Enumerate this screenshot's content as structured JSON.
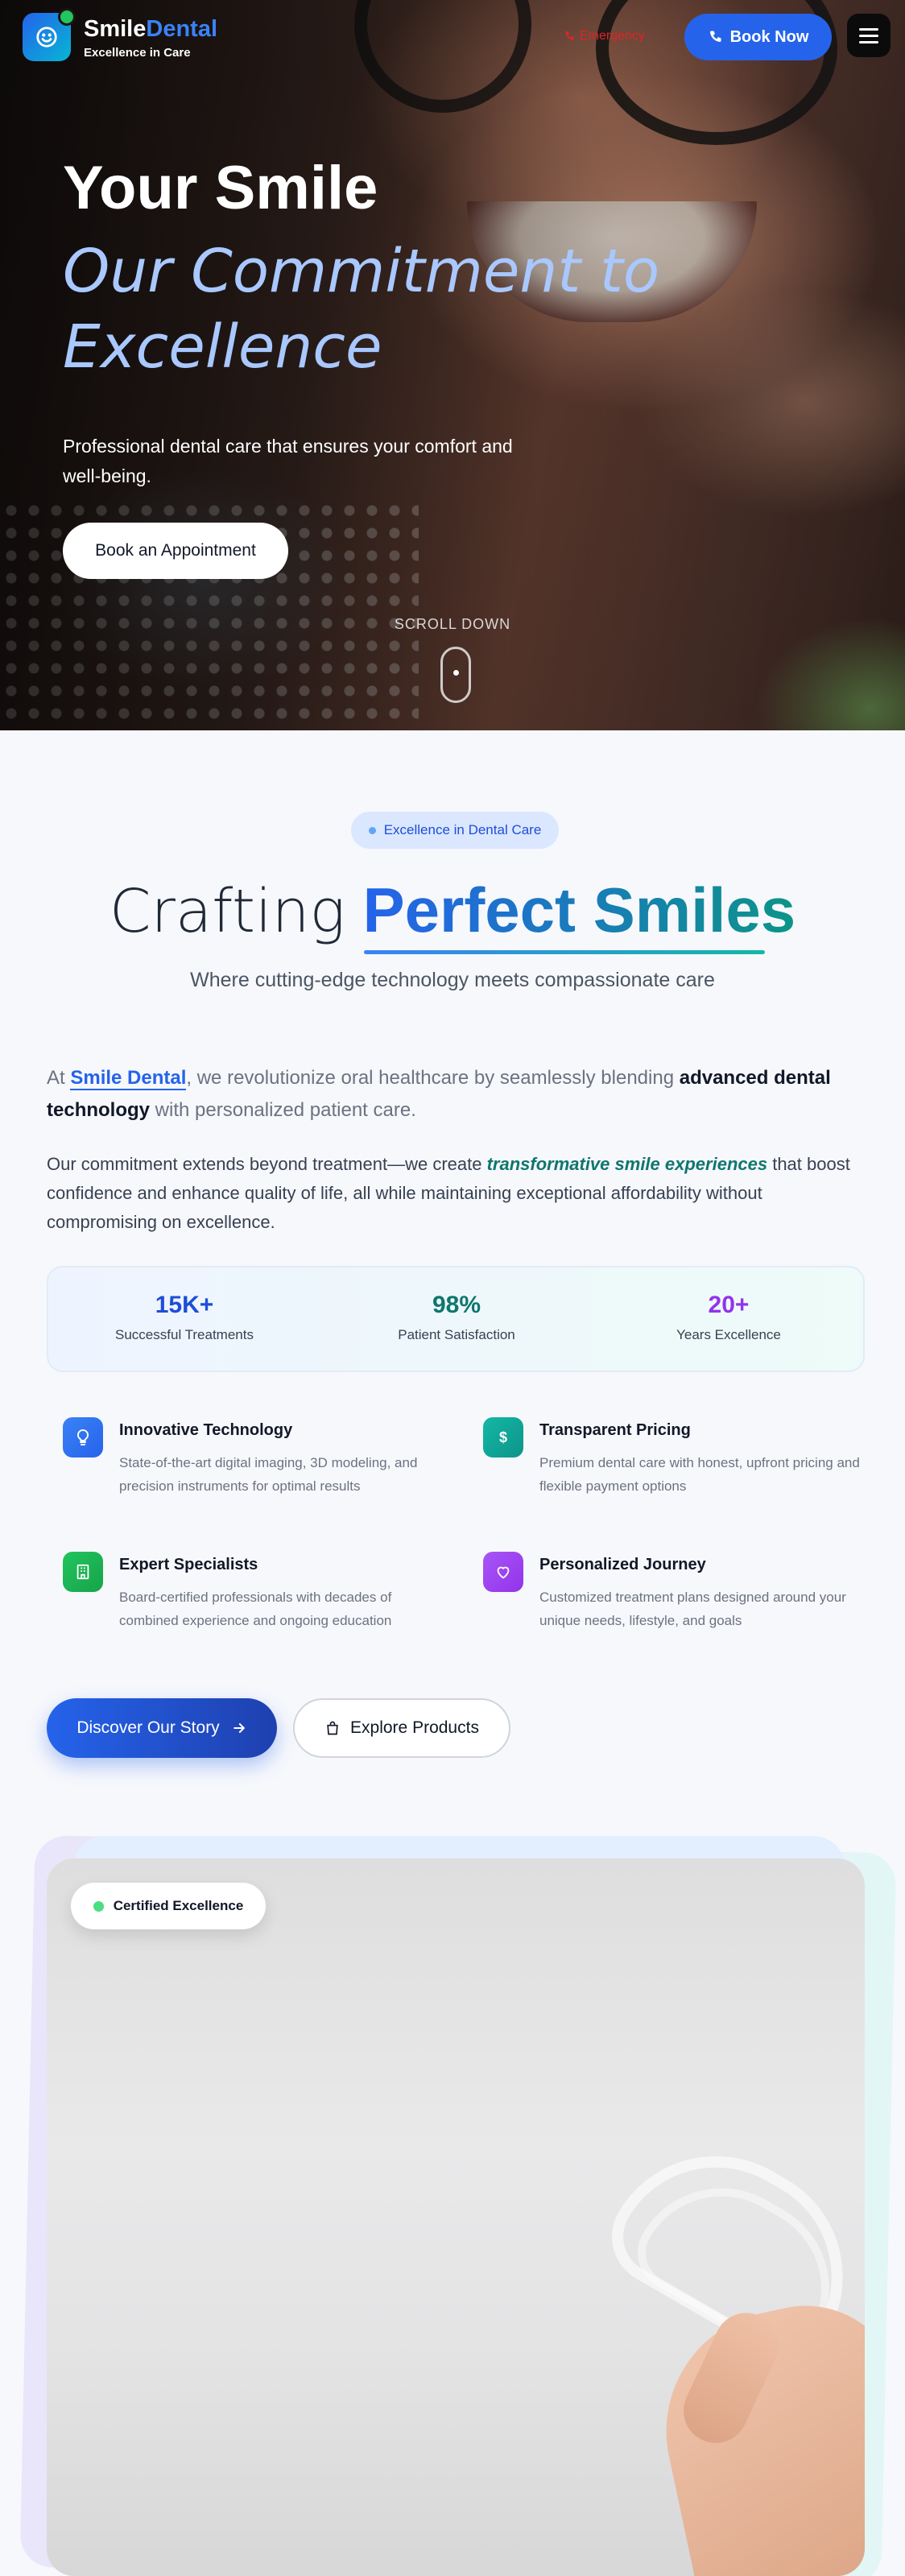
{
  "header": {
    "brand_part1": "Smile",
    "brand_part2": "Dental",
    "tagline": "Excellence in Care",
    "emergency_label": "Emergency",
    "book_now_label": "Book Now",
    "menu_icon": "hamburger-icon"
  },
  "hero": {
    "title": "Your Smile",
    "subtitle": "Our Commitment to Excellence",
    "description": "Professional dental care that ensures your comfort and well-being.",
    "cta_label": "Book an Appointment",
    "scroll_label": "SCROLL DOWN"
  },
  "about": {
    "badge": "Excellence in Dental Care",
    "title_part1": "Crafting",
    "title_part2": "Perfect Smiles",
    "subtitle": "Where cutting-edge technology meets compassionate care",
    "para1": {
      "prefix": "At ",
      "brand": "Smile Dental",
      "middle": ", we revolutionize oral healthcare by seamlessly blending ",
      "strong": "advanced dental technology",
      "suffix": " with personalized patient care."
    },
    "para2": {
      "prefix": "Our commitment extends beyond treatment—we create ",
      "emphasis": "transformative smile experiences",
      "suffix": " that boost confidence and enhance quality of life, all while maintaining exceptional affordability without compromising on excellence."
    },
    "stats": [
      {
        "value": "15K+",
        "label": "Successful Treatments",
        "color": "#1d4ed8"
      },
      {
        "value": "98%",
        "label": "Patient Satisfaction",
        "color": "#0f766e"
      },
      {
        "value": "20+",
        "label": "Years Excellence",
        "color": "#9333ea"
      }
    ],
    "features": [
      {
        "title": "Innovative Technology",
        "description": "State-of-the-art digital imaging, 3D modeling, and precision instruments for optimal results",
        "icon": "lightbulb-icon",
        "color": "#2563eb"
      },
      {
        "title": "Transparent Pricing",
        "description": "Premium dental care with honest, upfront pricing and flexible payment options",
        "icon": "dollar-icon",
        "color": "#0d9488"
      },
      {
        "title": "Expert Specialists",
        "description": "Board-certified professionals with decades of combined experience and ongoing education",
        "icon": "building-icon",
        "color": "#16a34a"
      },
      {
        "title": "Personalized Journey",
        "description": "Customized treatment plans designed around your unique needs, lifestyle, and goals",
        "icon": "heart-icon",
        "color": "#9333ea"
      }
    ],
    "btn_story": "Discover Our Story",
    "btn_products": "Explore Products"
  },
  "image_card": {
    "badge": "Certified Excellence"
  }
}
